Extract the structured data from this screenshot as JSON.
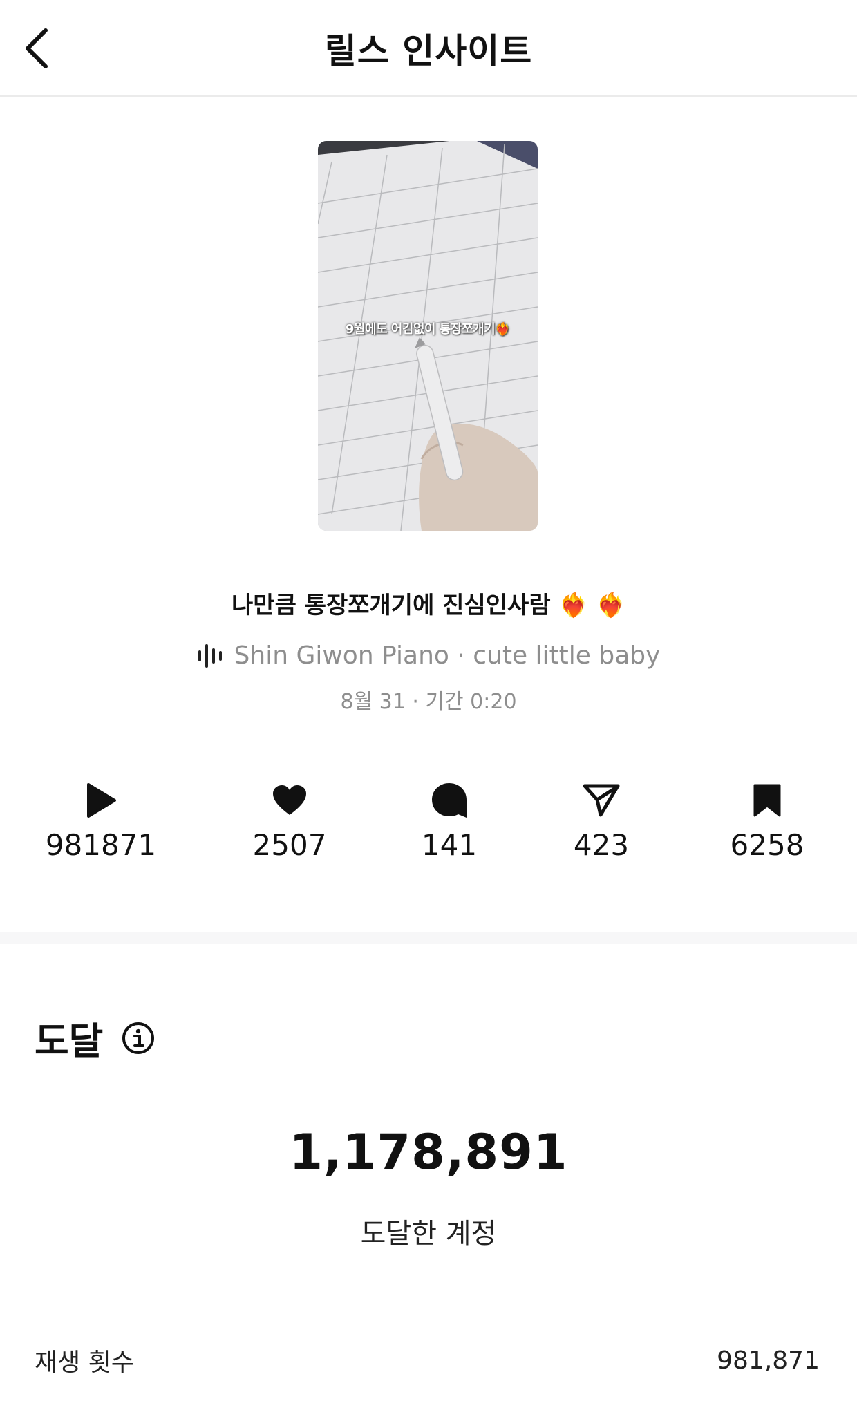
{
  "header": {
    "title": "릴스 인사이트",
    "back_icon": "chevron-left-icon"
  },
  "reel": {
    "thumbnail_caption": "9월에도 어김없이 통장쪼개기❤️‍🔥",
    "title_text": "나만큼 통장쪼개기에 진심인사람",
    "title_emoji": "❤️‍🔥 ❤️‍🔥",
    "audio_icon": "audio-waveform-icon",
    "audio": "Shin Giwon Piano · cute little baby",
    "meta": "8월 31 · 기간 0:20"
  },
  "stats": [
    {
      "icon": "play-icon",
      "value": "981871"
    },
    {
      "icon": "heart-icon",
      "value": "2507"
    },
    {
      "icon": "comment-icon",
      "value": "141"
    },
    {
      "icon": "share-icon",
      "value": "423"
    },
    {
      "icon": "bookmark-icon",
      "value": "6258"
    }
  ],
  "reach": {
    "section_title": "도달",
    "info_icon": "info-icon",
    "accounts_reached": "1,178,891",
    "accounts_reached_label": "도달한 계정",
    "plays_label": "재생 횟수",
    "plays_value": "981,871"
  }
}
